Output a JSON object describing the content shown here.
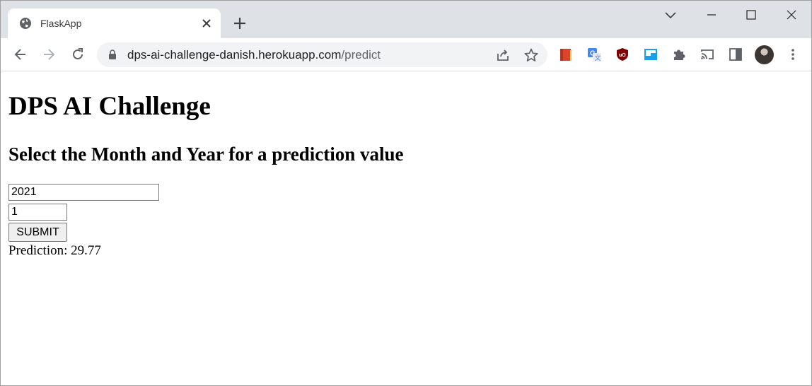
{
  "browser": {
    "tab": {
      "title": "FlaskApp",
      "favicon": "globe-icon"
    },
    "address": {
      "host": "dps-ai-challenge-danish.herokuapp.com",
      "path": "/predict"
    },
    "extensions": [
      "book-extension-icon",
      "google-translate-icon",
      "ublock-origin-icon",
      "tab-manager-icon",
      "puzzle-piece-icon",
      "cast-icon",
      "side-panel-icon"
    ]
  },
  "page": {
    "title": "DPS AI Challenge",
    "subtitle": "Select the Month and Year for a prediction value",
    "form": {
      "year_value": "2021",
      "month_value": "1",
      "submit_label": "SUBMIT"
    },
    "prediction_text": "Prediction: 29.77"
  },
  "colors": {
    "tabstrip": "#dee1e6",
    "omnibox": "#f1f3f4",
    "icon_gray": "#5f6368"
  }
}
